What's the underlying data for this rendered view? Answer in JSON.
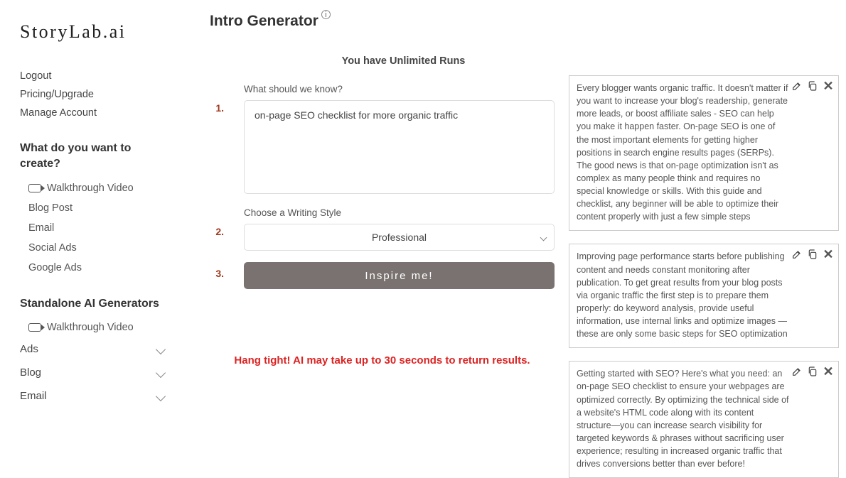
{
  "logo": "StoryLab.ai",
  "sidebar": {
    "links": [
      "Logout",
      "Pricing/Upgrade",
      "Manage Account"
    ],
    "heading1": "What do you want to create?",
    "create_items": [
      "Walkthrough Video",
      "Blog Post",
      "Email",
      "Social Ads",
      "Google Ads"
    ],
    "heading2": "Standalone AI Generators",
    "standalone_items": [
      "Walkthrough Video"
    ],
    "collapsibles": [
      "Ads",
      "Blog",
      "Email"
    ]
  },
  "page_title": "Intro Generator",
  "runs_notice": "You have Unlimited Runs",
  "steps": {
    "nums": [
      "1.",
      "2.",
      "3."
    ],
    "prompt_label": "What should we know?",
    "prompt_value": "on-page SEO checklist for more organic traffic",
    "style_label": "Choose a Writing Style",
    "style_value": "Professional",
    "inspire_label": "Inspire me!"
  },
  "waiting_message": "Hang tight! AI may take up to 30 seconds to return results.",
  "results": [
    "Every blogger wants organic traffic. It doesn't matter if you want to increase your blog's readership, generate more leads, or boost affiliate sales - SEO can help you make it happen faster. On-page SEO is one of the most important elements for getting higher positions in search engine results pages (SERPs). The good news is that on-page optimization isn't as complex as many people think and requires no special knowledge or skills. With this guide and checklist, any beginner will be able to optimize their content properly with just a few simple steps",
    "Improving page performance starts before publishing content and needs constant monitoring after publication. To get great results from your blog posts via organic traffic the first step is to prepare them properly: do keyword analysis, provide useful information, use internal links and optimize images — these are only some basic steps for SEO optimization",
    "Getting started with SEO? Here's what you need: an on-page SEO checklist to ensure your webpages are optimized correctly. By optimizing the technical side of a website's HTML code along with its content structure—you can increase search visibility for targeted keywords & phrases without sacrificing user experience; resulting in increased organic traffic that drives conversions better than ever before!"
  ]
}
